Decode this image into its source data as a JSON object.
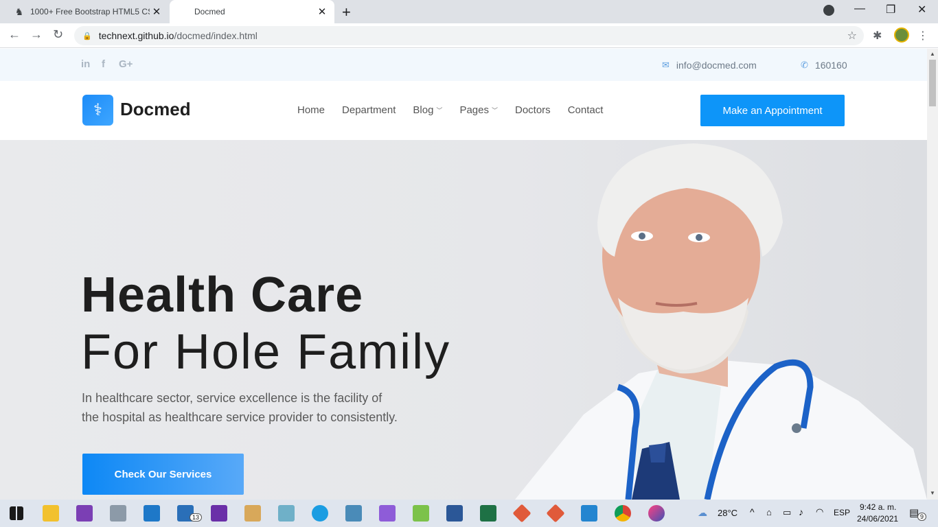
{
  "browser": {
    "tabs": [
      {
        "title": "1000+ Free Bootstrap HTML5 CS",
        "active": false
      },
      {
        "title": "Docmed",
        "active": true
      }
    ],
    "url_host": "technext.github.io",
    "url_path": "/docmed/index.html"
  },
  "topbar": {
    "social_icons": [
      "linkedin-icon",
      "facebook-icon",
      "google-plus-icon"
    ],
    "social_glyphs": [
      "in",
      "f",
      "G+"
    ],
    "email": "info@docmed.com",
    "phone": "160160"
  },
  "header": {
    "brand": "Docmed",
    "menu": [
      {
        "label": "Home",
        "dropdown": false
      },
      {
        "label": "Department",
        "dropdown": false
      },
      {
        "label": "Blog",
        "dropdown": true
      },
      {
        "label": "Pages",
        "dropdown": true
      },
      {
        "label": "Doctors",
        "dropdown": false
      },
      {
        "label": "Contact",
        "dropdown": false
      }
    ],
    "appointment_button": "Make an Appointment"
  },
  "hero": {
    "title_line1": "Health Care",
    "title_line2": "For Hole Family",
    "paragraph_line1": "In healthcare sector, service excellence is the facility of",
    "paragraph_line2": "the hospital as healthcare service provider to consistently.",
    "cta_button": "Check Our Services"
  },
  "taskbar": {
    "weather": "28°C",
    "language": "ESP",
    "time": "9:42 a. m.",
    "date": "24/06/2021",
    "mail_badge": "13",
    "notification_badge": "9"
  },
  "colors": {
    "accent": "#0d95f9",
    "topbar_bg": "#f2f8fd",
    "hero_bg": "#e7e8eb"
  }
}
